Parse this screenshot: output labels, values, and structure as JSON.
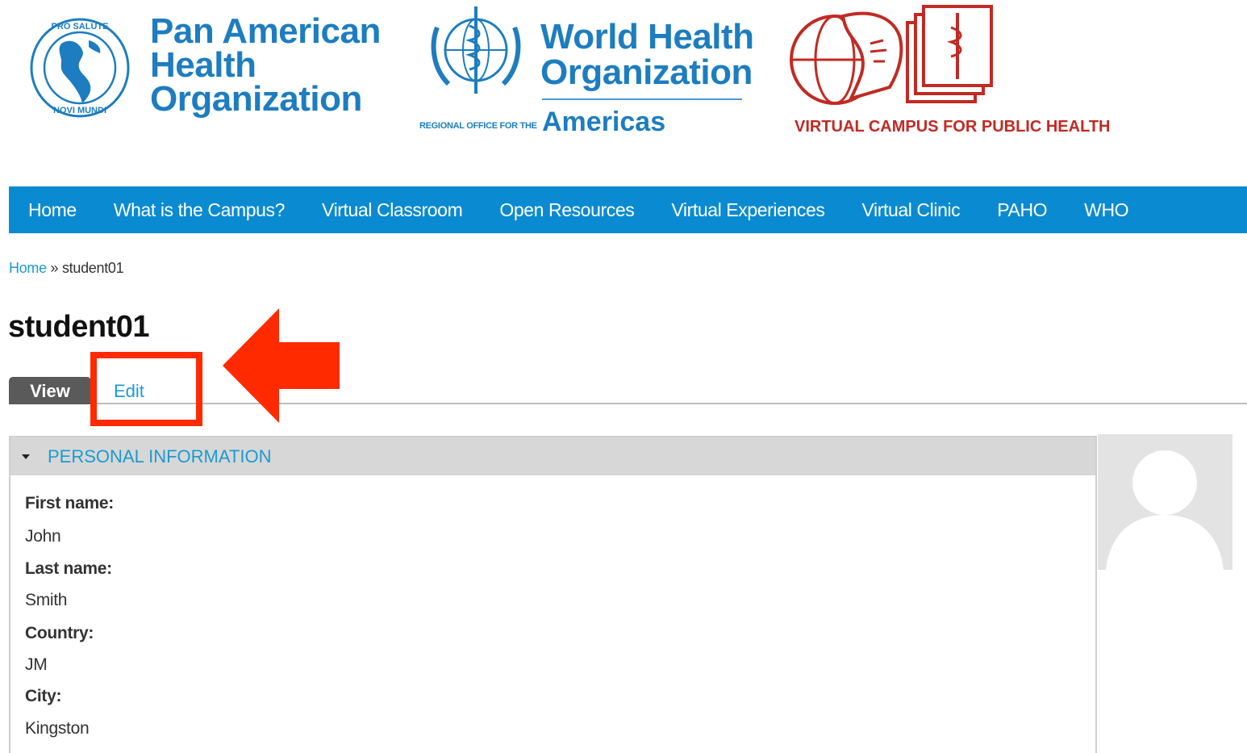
{
  "header": {
    "paho_logo": {
      "icon": "paho-emblem-icon",
      "name_lines": [
        "Pan American",
        "Health",
        "Organization"
      ],
      "emblem_text_top": "PRO SALUTE",
      "emblem_text_bottom": "NOVI MUNDI"
    },
    "who_logo": {
      "icon": "who-emblem-icon",
      "name_lines": [
        "World Health",
        "Organization"
      ],
      "region_small": "REGIONAL OFFICE FOR THE",
      "region_big": "Americas"
    },
    "vc_logo": {
      "icon": "virtual-campus-emblem-icon",
      "name": "VIRTUAL CAMPUS FOR PUBLIC HEALTH"
    },
    "colors": {
      "paho_blue": "#1d7dc0",
      "campus_red": "#c12a24"
    }
  },
  "nav": {
    "background": "#0a8bd1",
    "items": [
      {
        "label": "Home"
      },
      {
        "label": "What is the Campus?"
      },
      {
        "label": "Virtual Classroom"
      },
      {
        "label": "Open Resources"
      },
      {
        "label": "Virtual Experiences"
      },
      {
        "label": "Virtual Clinic"
      },
      {
        "label": "PAHO"
      },
      {
        "label": "WHO"
      }
    ]
  },
  "breadcrumb": {
    "home_label": "Home",
    "separator": "»",
    "current": "student01"
  },
  "page": {
    "title": "student01"
  },
  "tabs": {
    "view_label": "View",
    "edit_label": "Edit",
    "annotation_color": "#ff2a00"
  },
  "personal_info": {
    "title": "PERSONAL INFORMATION",
    "fields": [
      {
        "label": "First name:",
        "value": "John"
      },
      {
        "label": "Last name:",
        "value": "Smith"
      },
      {
        "label": "Country:",
        "value": "JM"
      },
      {
        "label": "City:",
        "value": "Kingston"
      }
    ]
  },
  "avatar": {
    "icon": "default-user-avatar-icon"
  }
}
